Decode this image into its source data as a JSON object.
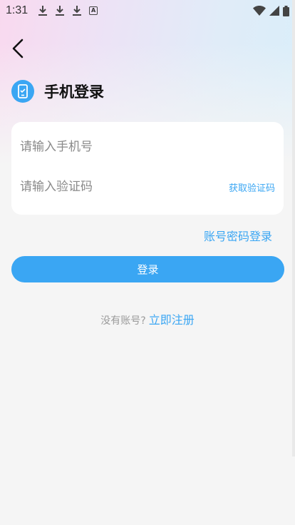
{
  "status_bar": {
    "time": "1:31",
    "badge_letter": "A",
    "icons": [
      "download-icon",
      "download-icon",
      "download-icon",
      "a-notification-icon",
      "wifi-icon",
      "signal-icon",
      "battery-icon"
    ]
  },
  "header": {
    "back_icon": "chevron-left-icon",
    "title": "手机登录",
    "title_icon": "phone-check-icon"
  },
  "form": {
    "phone_placeholder": "请输入手机号",
    "phone_value": "",
    "code_placeholder": "请输入验证码",
    "code_value": "",
    "get_code_label": "获取验证码"
  },
  "links": {
    "password_login": "账号密码登录",
    "register_hint": "没有账号?",
    "register_link": "立即注册"
  },
  "actions": {
    "login_label": "登录"
  },
  "colors": {
    "accent": "#3aa6f3",
    "background": "#f5f5f5",
    "card": "#ffffff",
    "title": "#111111",
    "placeholder": "#8a8a8a"
  }
}
